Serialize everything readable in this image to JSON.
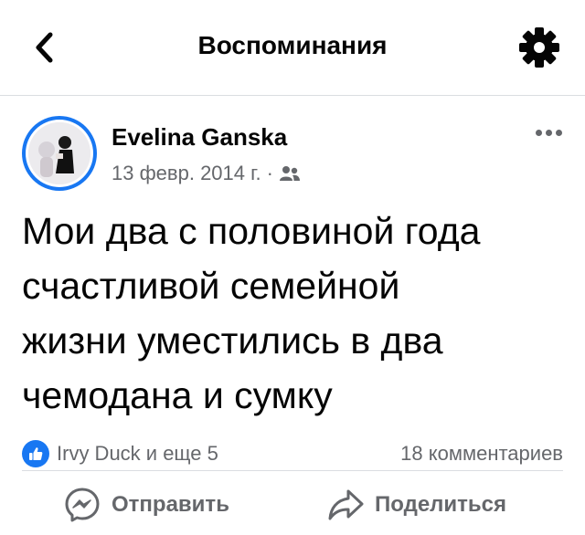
{
  "header": {
    "title": "Воспоминания",
    "back_icon": "chevron-left-icon",
    "settings_icon": "gear-icon"
  },
  "post": {
    "author": "Evelina Ganska",
    "date": "13 февр. 2014 г.",
    "separator": "·",
    "audience_icon": "friends-icon",
    "text_lines": [
      "Мои два с половиной года",
      "счастливой семейной",
      "жизни уместились в два",
      "чемодана и сумку"
    ],
    "reactions": "Irvy Duck и еще 5",
    "comments": "18 комментариев"
  },
  "actions": {
    "send_label": "Отправить",
    "share_label": "Поделиться"
  },
  "colors": {
    "accent": "#1877f2",
    "text": "#050505",
    "secondary": "#65676b",
    "divider": "#dadde1"
  }
}
